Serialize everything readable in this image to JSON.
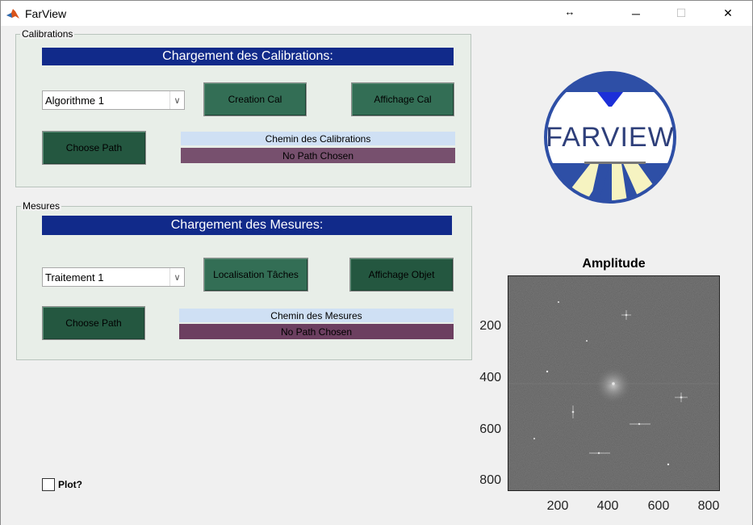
{
  "window": {
    "title": "FarView",
    "app_icon": "matlab-icon",
    "resize_glyph": "↔",
    "min_glyph": "─",
    "max_glyph": "☐",
    "close_glyph": "✕"
  },
  "calibrations": {
    "panel_title": "Calibrations",
    "banner": "Chargement des Calibrations:",
    "algorithm_select": "Algorithme 1",
    "creation_button": "Creation Cal",
    "affichage_button": "Affichage Cal",
    "choose_path_button": "Choose Path",
    "path_header": "Chemin des Calibrations",
    "path_value": "No Path Chosen"
  },
  "mesures": {
    "panel_title": "Mesures",
    "banner": "Chargement des Mesures:",
    "treatment_select": "Traitement 1",
    "localisation_button": "Localisation Tâches",
    "affichage_button": "Affichage Objet",
    "choose_path_button": "Choose Path",
    "path_header": "Chemin des Mesures",
    "path_value": "No Path Chosen"
  },
  "plot_checkbox": {
    "label": "Plot?",
    "checked": false
  },
  "logo": {
    "text": "FARVIEW"
  },
  "amplitude_plot": {
    "title": "Amplitude",
    "y_ticks": [
      "200",
      "400",
      "600",
      "800"
    ],
    "x_ticks": [
      "200",
      "400",
      "600",
      "800"
    ]
  },
  "colors": {
    "banner": "#112a8a",
    "button": "#336e55",
    "path_header": "#cfe0f4",
    "path_value": "#77506e"
  }
}
